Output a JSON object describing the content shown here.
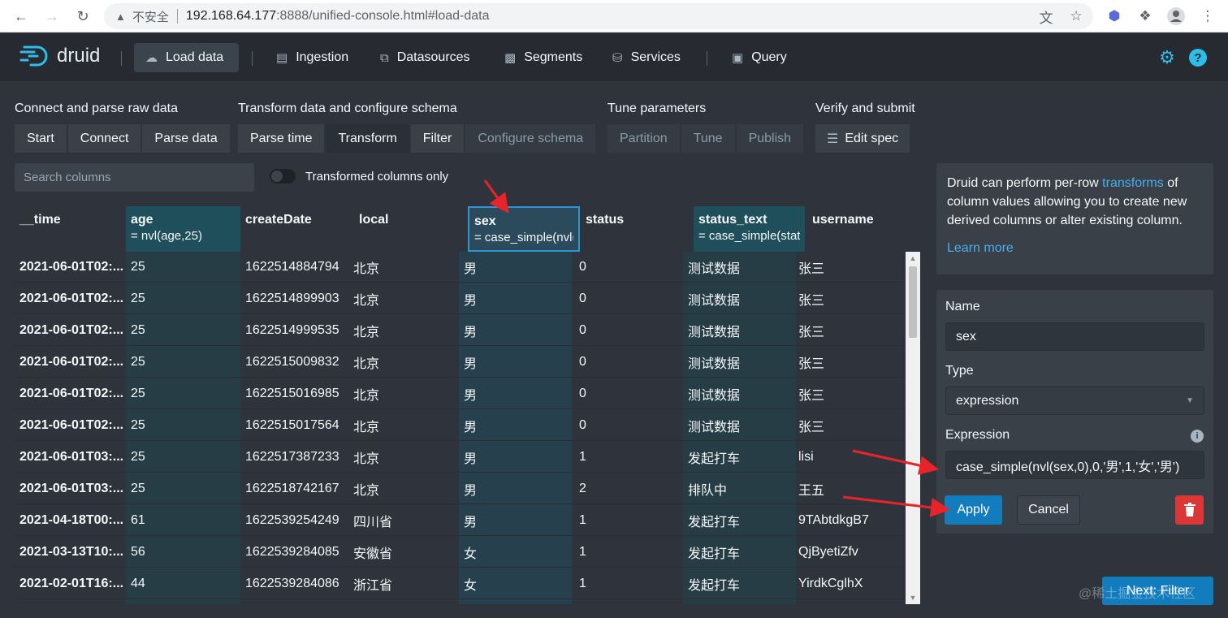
{
  "browser": {
    "insecure_label": "不安全",
    "url_host": "192.168.64.177",
    "url_rest": ":8888/unified-console.html#load-data"
  },
  "navbar": {
    "logo_text": "druid",
    "items": [
      {
        "label": "Load data",
        "icon": "cloud-upload-icon"
      },
      {
        "label": "Ingestion",
        "icon": "gantt-chart-icon"
      },
      {
        "label": "Datasources",
        "icon": "multi-select-icon"
      },
      {
        "label": "Segments",
        "icon": "stacked-chart-icon"
      },
      {
        "label": "Services",
        "icon": "database-icon"
      },
      {
        "label": "Query",
        "icon": "application-icon"
      }
    ]
  },
  "steps": {
    "groups": [
      {
        "title": "Connect and parse raw data",
        "buttons": [
          "Start",
          "Connect",
          "Parse data"
        ]
      },
      {
        "title": "Transform data and configure schema",
        "buttons": [
          "Parse time",
          "Transform",
          "Filter",
          "Configure schema"
        ]
      },
      {
        "title": "Tune parameters",
        "buttons": [
          "Partition",
          "Tune",
          "Publish"
        ]
      },
      {
        "title": "Verify and submit",
        "buttons": [
          "Edit spec"
        ]
      }
    ]
  },
  "search": {
    "placeholder": "Search columns"
  },
  "toggle": {
    "label": "Transformed columns only"
  },
  "table": {
    "columns": [
      {
        "name": "__time",
        "expr": ""
      },
      {
        "name": "age",
        "expr": "= nvl(age,25)"
      },
      {
        "name": "createDate",
        "expr": ""
      },
      {
        "name": "local",
        "expr": ""
      },
      {
        "name": "sex",
        "expr": "= case_simple(nvl("
      },
      {
        "name": "status",
        "expr": ""
      },
      {
        "name": "status_text",
        "expr": "= case_simple(stat"
      },
      {
        "name": "username",
        "expr": ""
      }
    ],
    "rows": [
      [
        "2021-06-01T02:...",
        "25",
        "1622514884794",
        "北京",
        "男",
        "0",
        "测试数据",
        "张三"
      ],
      [
        "2021-06-01T02:...",
        "25",
        "1622514899903",
        "北京",
        "男",
        "0",
        "测试数据",
        "张三"
      ],
      [
        "2021-06-01T02:...",
        "25",
        "1622514999535",
        "北京",
        "男",
        "0",
        "测试数据",
        "张三"
      ],
      [
        "2021-06-01T02:...",
        "25",
        "1622515009832",
        "北京",
        "男",
        "0",
        "测试数据",
        "张三"
      ],
      [
        "2021-06-01T02:...",
        "25",
        "1622515016985",
        "北京",
        "男",
        "0",
        "测试数据",
        "张三"
      ],
      [
        "2021-06-01T02:...",
        "25",
        "1622515017564",
        "北京",
        "男",
        "0",
        "测试数据",
        "张三"
      ],
      [
        "2021-06-01T03:...",
        "25",
        "1622517387233",
        "北京",
        "男",
        "1",
        "发起打车",
        "lisi"
      ],
      [
        "2021-06-01T03:...",
        "25",
        "1622518742167",
        "北京",
        "男",
        "2",
        "排队中",
        "王五"
      ],
      [
        "2021-04-18T00:...",
        "61",
        "1622539254249",
        "四川省",
        "男",
        "1",
        "发起打车",
        "9TAbtdkgB7"
      ],
      [
        "2021-03-13T10:...",
        "56",
        "1622539284085",
        "安徽省",
        "女",
        "1",
        "发起打车",
        "QjByetiZfv"
      ],
      [
        "2021-02-01T16:...",
        "44",
        "1622539284086",
        "浙江省",
        "女",
        "1",
        "发起打车",
        "YirdkCglhX"
      ]
    ]
  },
  "info": {
    "text_before": "Druid can perform per-row ",
    "link": "transforms",
    "text_after": " of column values allowing you to create new derived columns or alter existing column.",
    "learn_more": "Learn more"
  },
  "form": {
    "name_label": "Name",
    "name_value": "sex",
    "type_label": "Type",
    "type_value": "expression",
    "expression_label": "Expression",
    "expression_value": "case_simple(nvl(sex,0),0,'男',1,'女','男')",
    "apply": "Apply",
    "cancel": "Cancel"
  },
  "next_button": "Next: Filter",
  "watermark": "@稀土掘金技术社区"
}
